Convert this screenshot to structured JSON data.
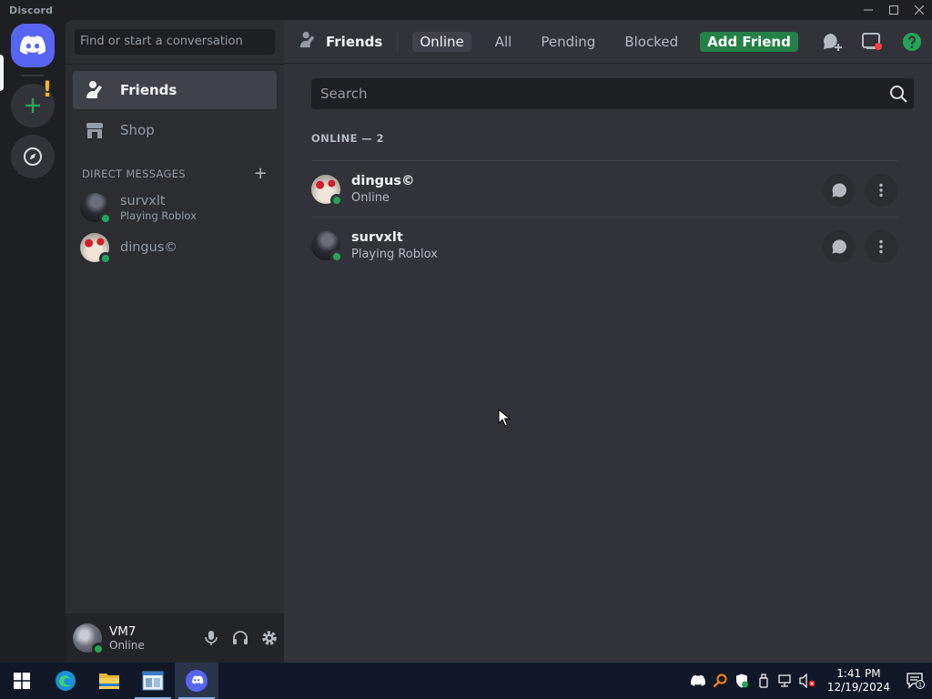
{
  "window": {
    "title": "Discord",
    "controls": [
      "minimize-icon",
      "maximize-icon",
      "close-icon"
    ]
  },
  "colors": {
    "brand": "#5865f2",
    "online": "#23a55a",
    "add_friend": "#248046",
    "sidebar_bg": "#2b2d31",
    "main_bg": "#313338",
    "taskbar_bg": "#101827"
  },
  "rail": {
    "items": [
      "discord-home-icon",
      "add-server-icon",
      "explore-icon"
    ]
  },
  "sidebar": {
    "search_placeholder": "Find or start a conversation",
    "nav": [
      {
        "label": "Friends",
        "icon": "friends-icon",
        "selected": true
      },
      {
        "label": "Shop",
        "icon": "shop-icon",
        "selected": false
      }
    ],
    "dm_header": "DIRECT MESSAGES",
    "dm_add_glyph": "+",
    "dms": [
      {
        "name": "survxlt",
        "activity": "Playing Roblox",
        "status": "online"
      },
      {
        "name": "dingus©",
        "activity": "",
        "status": "online"
      }
    ]
  },
  "user_panel": {
    "name": "VM7",
    "status": "Online",
    "controls": [
      "microphone-icon",
      "headphones-icon",
      "settings-icon"
    ]
  },
  "topbar": {
    "title": "Friends",
    "tabs": [
      "Online",
      "All",
      "Pending",
      "Blocked"
    ],
    "active_tab": "Online",
    "add_friend": "Add Friend",
    "right_icons": [
      "new-group-dm-icon",
      "inbox-icon",
      "help-icon"
    ]
  },
  "friends": {
    "search_placeholder": "Search",
    "section_header": "ONLINE — 2",
    "list": [
      {
        "name": "dingus©",
        "status_text": "Online"
      },
      {
        "name": "survxlt",
        "status_text": "Playing Roblox"
      }
    ]
  },
  "taskbar": {
    "apps": [
      "windows-start-icon",
      "edge-icon",
      "file-explorer-icon",
      "app-window-icon",
      "discord-icon"
    ],
    "active_app": "discord-icon",
    "time": "1:41 PM",
    "date": "12/19/2024",
    "notification_count": "1"
  }
}
